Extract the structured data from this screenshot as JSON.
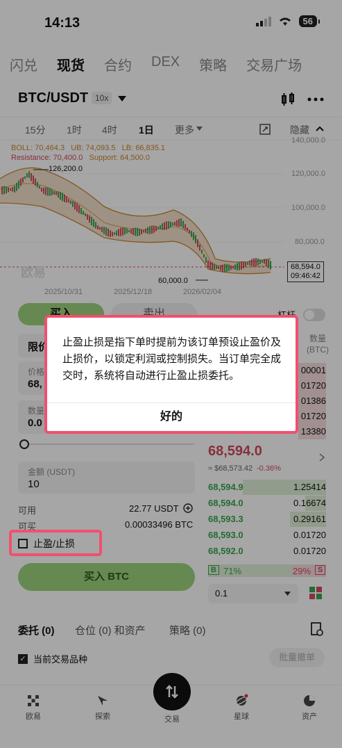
{
  "status_bar": {
    "time": "14:13",
    "battery": "56"
  },
  "top_tabs": [
    {
      "label": "闪兑",
      "active": false
    },
    {
      "label": "现货",
      "active": true
    },
    {
      "label": "合约",
      "active": false
    },
    {
      "label": "DEX",
      "active": false
    },
    {
      "label": "策略",
      "active": false
    },
    {
      "label": "交易广场",
      "active": false
    }
  ],
  "pair": {
    "symbol": "BTC/USDT",
    "leverage": "10x"
  },
  "timeframes": [
    {
      "label": "15分",
      "active": false
    },
    {
      "label": "1时",
      "active": false
    },
    {
      "label": "4时",
      "active": false
    },
    {
      "label": "1日",
      "active": true
    },
    {
      "label": "更多",
      "active": false
    }
  ],
  "chart_toolbar": {
    "hide_label": "隐藏"
  },
  "chart": {
    "boll_line": "BOLL: 70,464.3",
    "ub": "UB: 74,093.5",
    "lb": "LB: 66,835.1",
    "resistance": "Resistance: 70,400.0",
    "support": "Support: 64,500.0",
    "high_label": "126,200.0",
    "low_label": "60,000.0",
    "y_ticks": [
      "140,000.0",
      "120,000.0",
      "100,000.0",
      "80,000.0"
    ],
    "x_ticks": [
      "2025/10/31",
      "2025/12/18",
      "2026/02/04"
    ],
    "last_price": "68,594.0",
    "countdown": "09:46:42",
    "watermark": "欧易"
  },
  "order_form": {
    "buy_label": "买入",
    "sell_label": "卖出",
    "order_type": "限价",
    "price_label": "价格",
    "price_value": "68,",
    "qty_label": "数量",
    "qty_value": "0.0",
    "amount_label": "金额 (USDT)",
    "amount_value": "10",
    "available_label": "可用",
    "available_value": "22.77 USDT",
    "can_buy_label": "可买",
    "can_buy_value": "0.00033496 BTC",
    "tpsl_label": "止盈/止损",
    "submit_label": "买入 BTC",
    "toggle_label": "杠杆"
  },
  "order_book": {
    "qty_header": "数量",
    "unit": "(BTC)",
    "asks_qty": [
      "00001",
      "01720",
      "01386",
      "01720",
      "13380"
    ],
    "mid_price": "68,594.0",
    "mid_sub": "≈ $68,573.42",
    "mid_change": "-0.36%",
    "bids": [
      {
        "price": "68,594.9",
        "qty": "1.25414"
      },
      {
        "price": "68,594.0",
        "qty": "0.16674"
      },
      {
        "price": "68,593.3",
        "qty": "0.29161"
      },
      {
        "price": "68,593.0",
        "qty": "0.01720"
      },
      {
        "price": "68,592.0",
        "qty": "0.01720"
      }
    ],
    "buy_ratio": "71%",
    "sell_ratio": "29%",
    "buy_tag": "B",
    "sell_tag": "S",
    "precision": "0.1"
  },
  "bottom_tabs": {
    "orders": "委托 (0)",
    "positions": "仓位 (0) 和资产",
    "strategies": "策略 (0)",
    "current_pair": "当前交易品种",
    "batch_cancel": "批量撤单"
  },
  "nav": [
    {
      "label": "欧易",
      "icon": "okx-logo-icon"
    },
    {
      "label": "探索",
      "icon": "compass-icon"
    },
    {
      "label": "交易",
      "icon": "trade-swap-icon"
    },
    {
      "label": "星球",
      "icon": "planet-icon"
    },
    {
      "label": "资产",
      "icon": "pie-chart-icon"
    }
  ],
  "dialog": {
    "message": "止盈止损是指下单时提前为该订单预设止盈价及止损价，以锁定利润或控制损失。当订单完全成交时，系统将自动进行止盈止损委托。",
    "ok_label": "好的"
  },
  "colors": {
    "accent_green": "#9bd37c",
    "sell_red": "#d14a5e",
    "highlight": "#f0506e"
  }
}
